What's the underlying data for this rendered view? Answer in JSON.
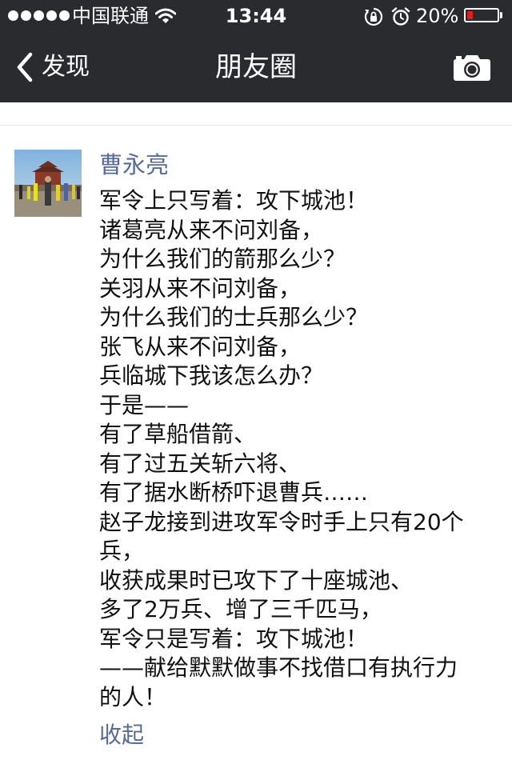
{
  "status_bar": {
    "carrier": "中国联通",
    "time": "13:44",
    "battery_percent": "20%",
    "battery_level": 0.2,
    "icons": [
      "signal-dots-icon",
      "wifi-icon",
      "rotation-lock-icon",
      "alarm-icon",
      "battery-icon"
    ]
  },
  "nav": {
    "back_label": "发现",
    "title": "朋友圈",
    "back_icon": "chevron-left-icon",
    "camera_icon": "camera-icon"
  },
  "post": {
    "author": "曹永亮",
    "lines": [
      "军令上只写着：攻下城池！",
      "诸葛亮从来不问刘备，",
      "为什么我们的箭那么少？",
      "关羽从来不问刘备，",
      "为什么我们的士兵那么少？",
      "张飞从来不问刘备，",
      "兵临城下我该怎么办？",
      "于是——",
      "有了草船借箭、",
      "有了过五关斩六将、",
      "有了据水断桥吓退曹兵……",
      "赵子龙接到进攻军令时手上只有20个",
      "兵，",
      "收获成果时已攻下了十座城池、",
      "多了2万兵、增了三千匹马，",
      "军令只是写着：攻下城池！",
      "——献给默默做事不找借口有执行力",
      "的人！"
    ],
    "collapse_label": "收起"
  },
  "colors": {
    "bar_background": "#2a2b2f",
    "link_blue": "#576b95",
    "text": "#111111",
    "battery_low": "#e02020"
  }
}
